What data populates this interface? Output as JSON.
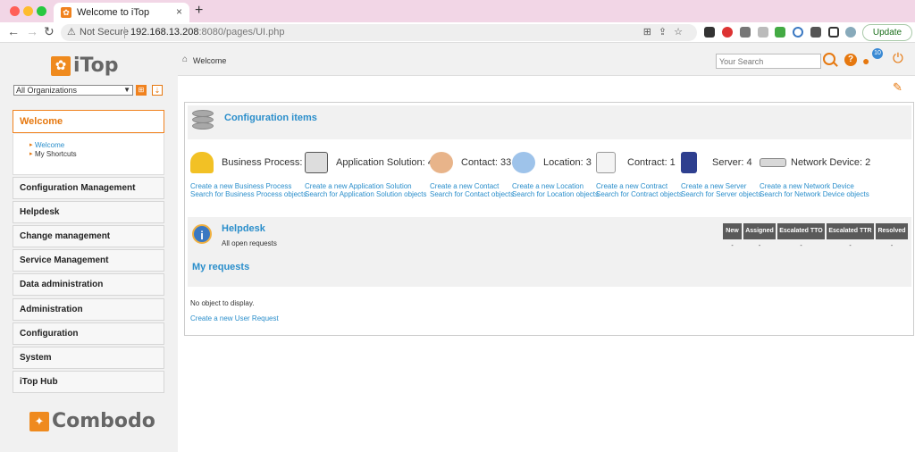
{
  "browser": {
    "tab_title": "Welcome to iTop",
    "tab_favicon": "itop-favicon",
    "security_label": "Not Secure",
    "url_host": "192.168.13.208",
    "url_rest": ":8080/pages/UI.php",
    "update_label": "Update"
  },
  "app": {
    "logo_text": "iTop",
    "org_select_value": "All Organizations",
    "breadcrumb": "Welcome",
    "search_placeholder": "Your Search",
    "notification_count": "10",
    "footer_logo_text": "Combodo",
    "colors": {
      "accent": "#e6780f",
      "link": "#2a8ecb"
    }
  },
  "sidebar": {
    "active_menu": "Welcome",
    "submenu": [
      "Welcome",
      "My Shortcuts"
    ],
    "menus": [
      "Configuration Management",
      "Helpdesk",
      "Change management",
      "Service Management",
      "Data administration",
      "Administration",
      "Configuration",
      "System",
      "iTop Hub"
    ]
  },
  "configuration_items": {
    "title": "Configuration items",
    "items": [
      {
        "label": "Business Process: 0",
        "icon": "business-process-icon",
        "create": "Create a new Business Process",
        "search": "Search for Business Process objects"
      },
      {
        "label": "Application Solution: 4",
        "icon": "application-solution-icon",
        "create": "Create a new Application Solution",
        "search": "Search for Application Solution objects"
      },
      {
        "label": "Contact: 33",
        "icon": "contact-icon",
        "create": "Create a new Contact",
        "search": "Search for Contact objects"
      },
      {
        "label": "Location: 3",
        "icon": "location-icon",
        "create": "Create a new Location",
        "search": "Search for Location objects"
      },
      {
        "label": "Contract: 1",
        "icon": "contract-icon",
        "create": "Create a new Contract",
        "search": "Search for Contract objects"
      },
      {
        "label": "Server: 4",
        "icon": "server-icon",
        "create": "Create a new Server",
        "search": "Search for Server objects"
      },
      {
        "label": "Network Device: 2",
        "icon": "network-device-icon",
        "create": "Create a new Network Device",
        "search": "Search for Network Device objects"
      }
    ]
  },
  "helpdesk": {
    "title": "Helpdesk",
    "subtitle": "All open requests",
    "columns": [
      "New",
      "Assigned",
      "Escalated TTO",
      "Escalated TTR",
      "Resolved"
    ],
    "values": [
      "-",
      "-",
      "-",
      "-",
      "-"
    ],
    "my_requests_title": "My requests",
    "no_object": "No object to display.",
    "create_link": "Create a new User Request"
  }
}
